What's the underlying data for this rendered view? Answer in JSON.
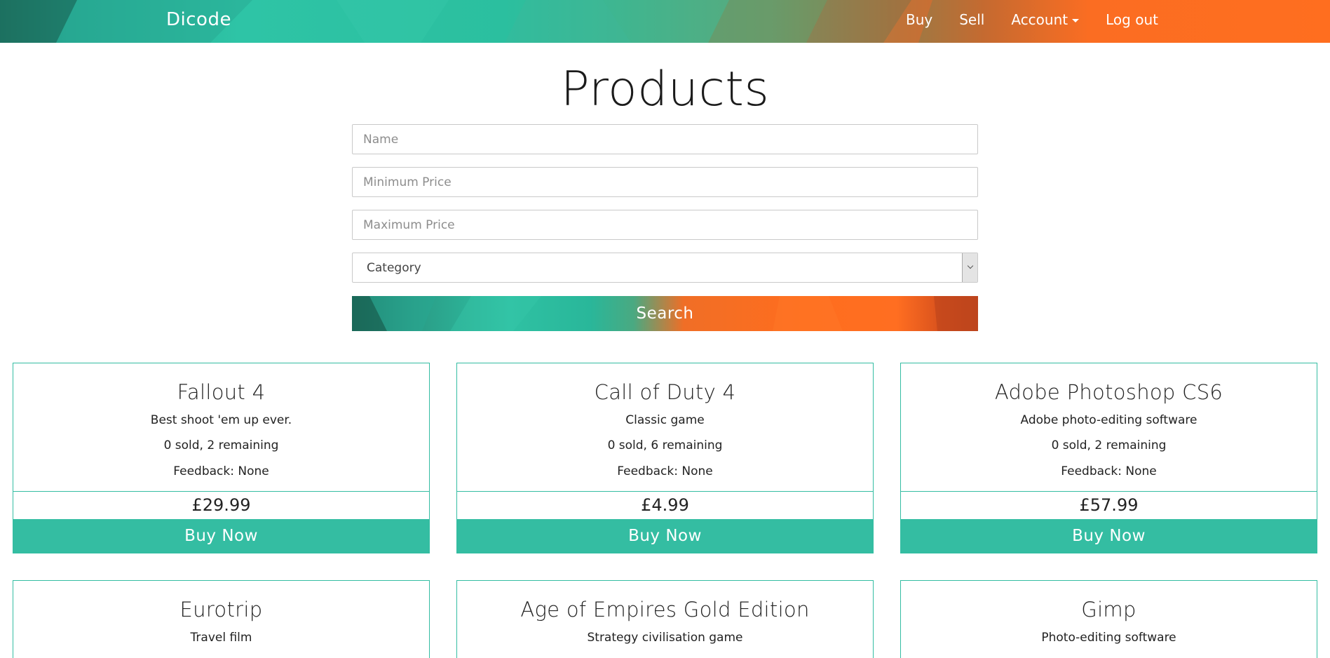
{
  "navbar": {
    "brand": "Dicode",
    "links": [
      "Buy",
      "Sell",
      "Account",
      "Log out"
    ]
  },
  "page": {
    "title": "Products"
  },
  "search": {
    "name_placeholder": "Name",
    "min_price_placeholder": "Minimum Price",
    "max_price_placeholder": "Maximum Price",
    "category_selected": "Category",
    "button_label": "Search"
  },
  "products": [
    {
      "name": "Fallout 4",
      "description": "Best shoot 'em up ever.",
      "stock": "0 sold, 2 remaining",
      "feedback": "Feedback: None",
      "price": "£29.99",
      "buy_label": "Buy Now"
    },
    {
      "name": "Call of Duty 4",
      "description": "Classic game",
      "stock": "0 sold, 6 remaining",
      "feedback": "Feedback: None",
      "price": "£4.99",
      "buy_label": "Buy Now"
    },
    {
      "name": "Adobe Photoshop CS6",
      "description": "Adobe photo-editing software",
      "stock": "0 sold, 2 remaining",
      "feedback": "Feedback: None",
      "price": "£57.99",
      "buy_label": "Buy Now"
    },
    {
      "name": "Eurotrip",
      "description": "Travel film"
    },
    {
      "name": "Age of Empires Gold Edition",
      "description": "Strategy civilisation game"
    },
    {
      "name": "Gimp",
      "description": "Photo-editing software"
    }
  ],
  "colors": {
    "accent": "#34bda2",
    "orange": "#ff6e1f",
    "teal": "#2ec4a6"
  }
}
